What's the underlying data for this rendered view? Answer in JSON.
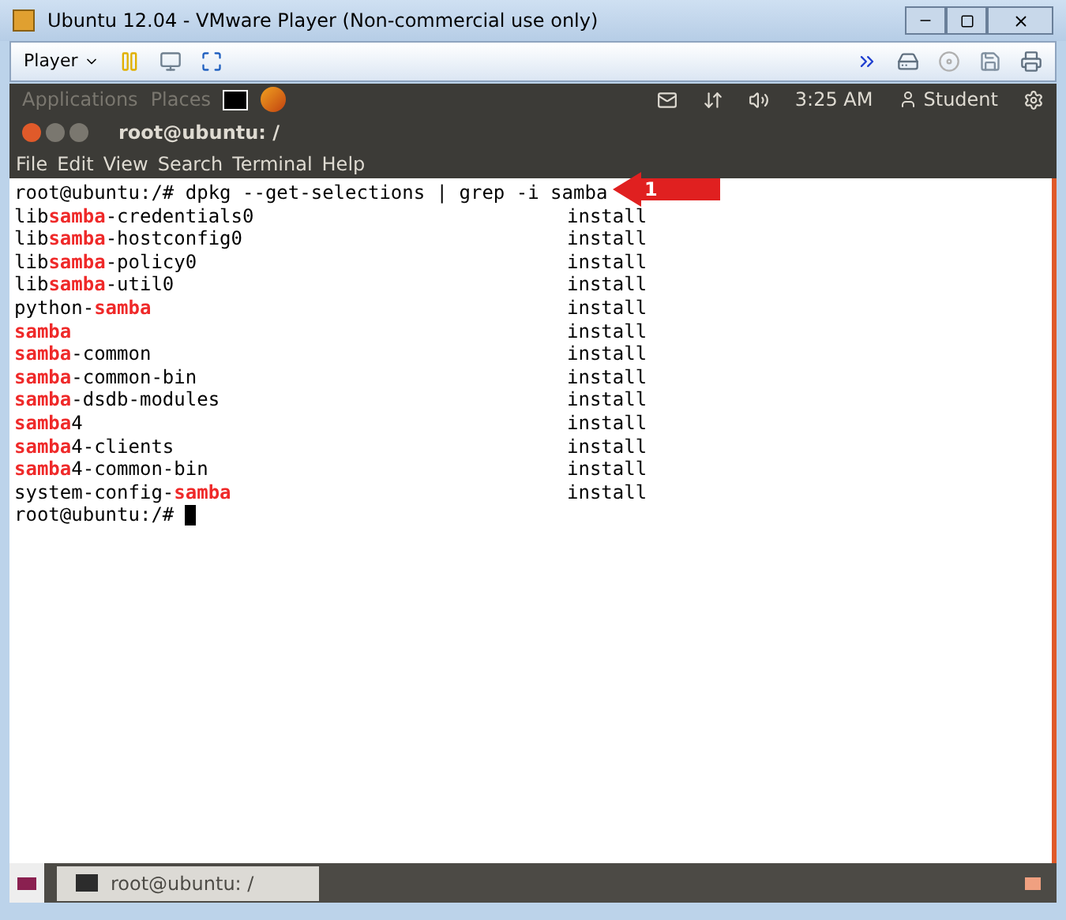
{
  "window": {
    "title": "Ubuntu 12.04 - VMware Player (Non-commercial use only)"
  },
  "toolbar": {
    "player_menu": "Player"
  },
  "top_panel": {
    "menus": [
      "Applications",
      "Places"
    ],
    "clock": "3:25 AM",
    "user": "Student"
  },
  "terminal": {
    "title": "root@ubuntu: /",
    "menu": [
      "File",
      "Edit",
      "View",
      "Search",
      "Terminal",
      "Help"
    ],
    "command": "root@ubuntu:/# dpkg --get-selections | grep -i samba",
    "rows": [
      {
        "name": "lib**samba**-credentials0",
        "status": "install"
      },
      {
        "name": "lib**samba**-hostconfig0",
        "status": "install"
      },
      {
        "name": "lib**samba**-policy0",
        "status": "install"
      },
      {
        "name": "lib**samba**-util0",
        "status": "install"
      },
      {
        "name": "python-**samba**",
        "status": "install"
      },
      {
        "name": "**samba**",
        "status": "install"
      },
      {
        "name": "**samba**-common",
        "status": "install"
      },
      {
        "name": "**samba**-common-bin",
        "status": "install"
      },
      {
        "name": "**samba**-dsdb-modules",
        "status": "install"
      },
      {
        "name": "**samba**4",
        "status": "install"
      },
      {
        "name": "**samba**4-clients",
        "status": "install"
      },
      {
        "name": "**samba**4-common-bin",
        "status": "install"
      },
      {
        "name": "system-config-**samba**",
        "status": "install"
      }
    ],
    "prompt": "root@ubuntu:/#"
  },
  "callout": {
    "label": "1"
  },
  "taskbar": {
    "items": [
      {
        "label": "root@ubuntu: /",
        "selected": true
      }
    ]
  }
}
